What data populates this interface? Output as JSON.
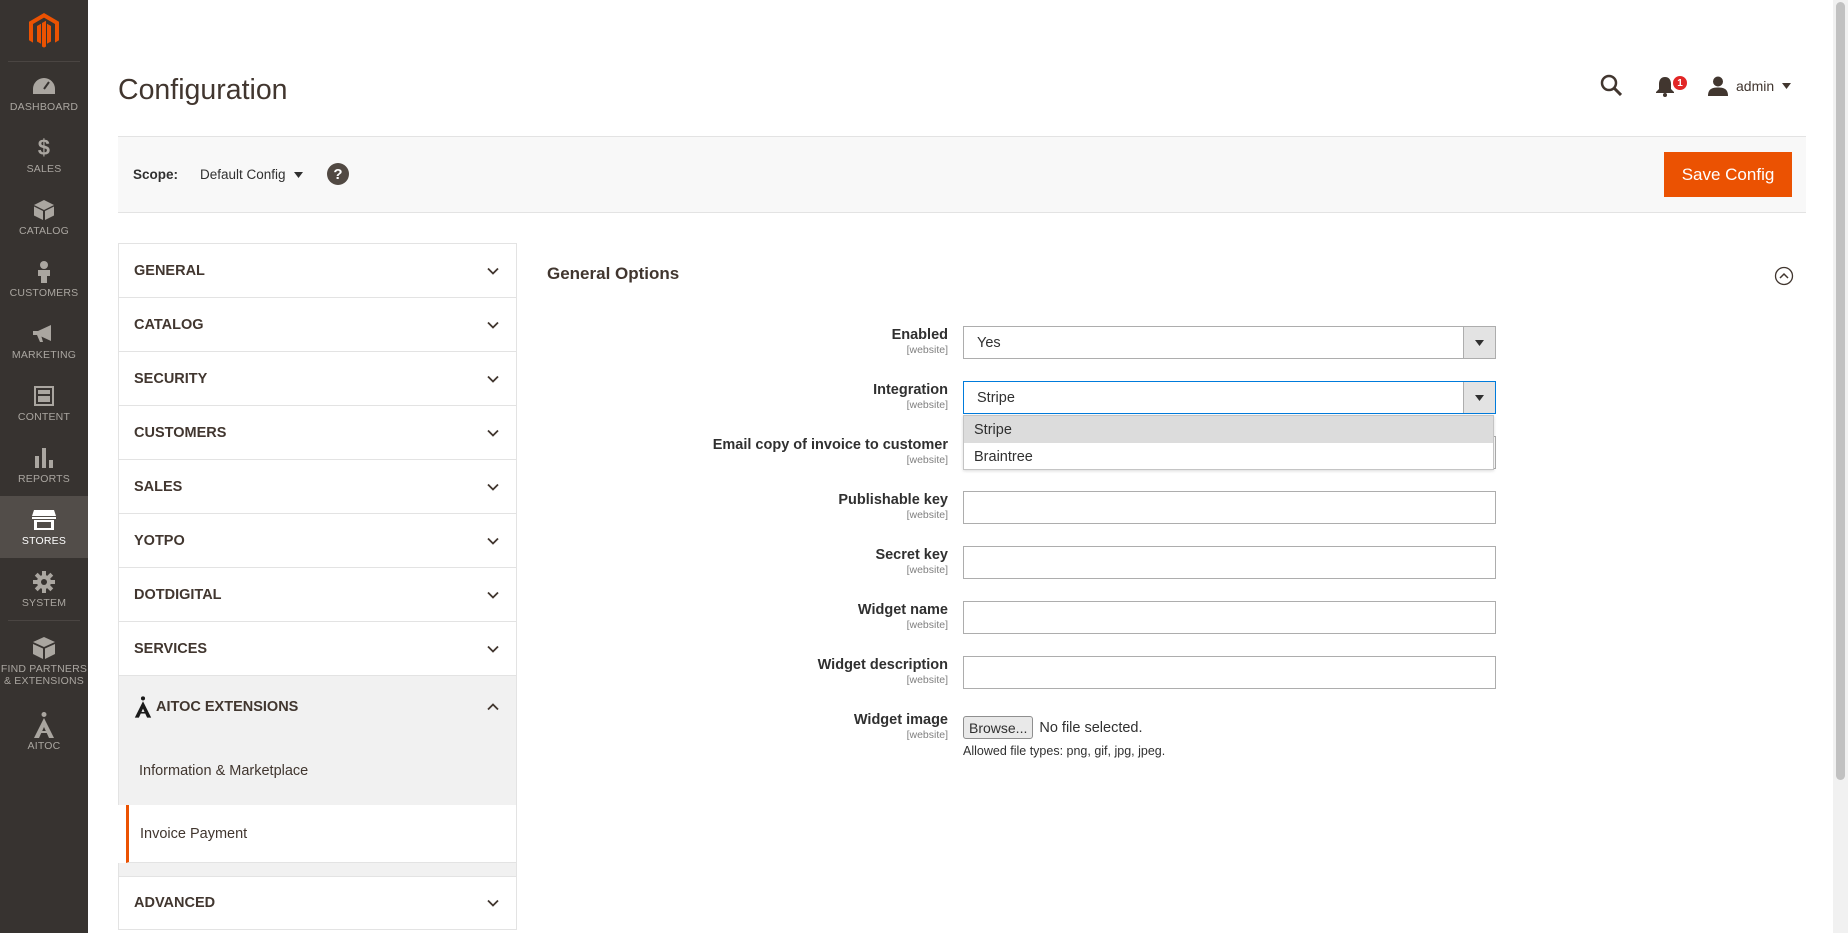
{
  "menu": {
    "items": [
      {
        "label": "DASHBOARD",
        "icon": "dashboard-icon"
      },
      {
        "label": "SALES",
        "icon": "dollar-icon"
      },
      {
        "label": "CATALOG",
        "icon": "box-icon"
      },
      {
        "label": "CUSTOMERS",
        "icon": "person-icon"
      },
      {
        "label": "MARKETING",
        "icon": "megaphone-icon"
      },
      {
        "label": "CONTENT",
        "icon": "layout-icon"
      },
      {
        "label": "REPORTS",
        "icon": "bar-chart-icon"
      },
      {
        "label": "STORES",
        "icon": "storefront-icon"
      },
      {
        "label": "SYSTEM",
        "icon": "gear-icon"
      },
      {
        "label": "FIND PARTNERS & EXTENSIONS",
        "icon": "blocks-icon"
      },
      {
        "label": "AITOC",
        "icon": "aitoc-logo-icon"
      }
    ],
    "active": "STORES"
  },
  "header": {
    "title": "Configuration",
    "notifications_count": "1",
    "user": "admin"
  },
  "scope": {
    "label": "Scope:",
    "value": "Default Config",
    "help": "?"
  },
  "actions": {
    "save_label": "Save Config"
  },
  "tabs": {
    "general": "GENERAL",
    "catalog": "CATALOG",
    "security": "SECURITY",
    "customers": "CUSTOMERS",
    "sales": "SALES",
    "yotpo": "YOTPO",
    "dotdigital": "DOTDIGITAL",
    "services": "SERVICES",
    "aitoc": "AITOC EXTENSIONS",
    "aitoc_items": [
      "Information & Marketplace",
      "Invoice Payment"
    ],
    "advanced": "ADVANCED"
  },
  "section": {
    "title": "General Options"
  },
  "fields": {
    "enabled": {
      "label": "Enabled",
      "scope": "[website]",
      "value": "Yes"
    },
    "integration": {
      "label": "Integration",
      "scope": "[website]",
      "value": "Stripe",
      "options": [
        "Stripe",
        "Braintree"
      ]
    },
    "email_copy": {
      "label": "Email copy of invoice to customer",
      "scope": "[website]"
    },
    "publishable_key": {
      "label": "Publishable key",
      "scope": "[website]"
    },
    "secret_key": {
      "label": "Secret key",
      "scope": "[website]"
    },
    "widget_name": {
      "label": "Widget name",
      "scope": "[website]"
    },
    "widget_description": {
      "label": "Widget description",
      "scope": "[website]"
    },
    "widget_image": {
      "label": "Widget image",
      "scope": "[website]",
      "browse": "Browse...",
      "status": "No file selected.",
      "note": "Allowed file types: png, gif, jpg, jpeg."
    }
  },
  "colors": {
    "accent": "#eb5202",
    "menu_bg": "#373330",
    "focus": "#007bdb"
  }
}
